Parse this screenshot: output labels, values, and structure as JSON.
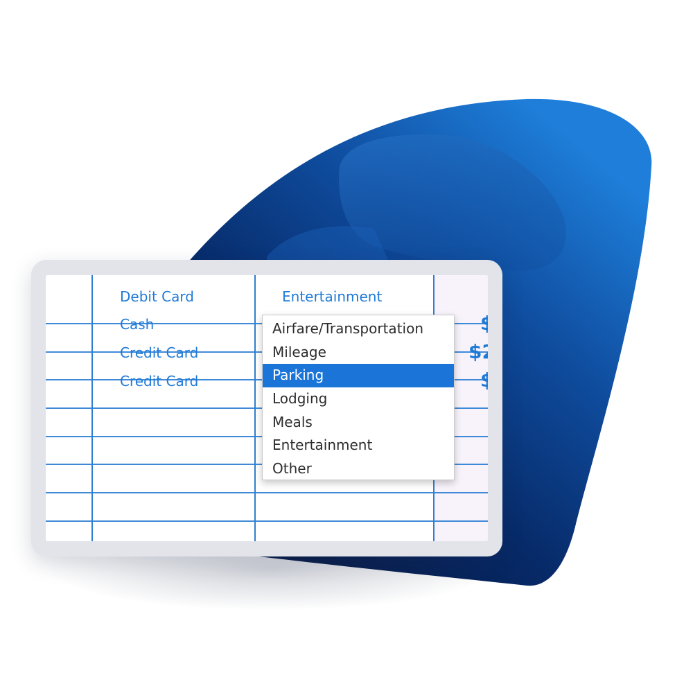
{
  "colors": {
    "accent": "#1f7ad6",
    "selected_bg": "#1b75d9",
    "grid_line": "#3f8ad8",
    "background_shape_dark": "#041a4a",
    "background_shape_light": "#1e7ed9"
  },
  "table": {
    "rows": [
      {
        "payment": "Debit Card",
        "category": "Entertainment",
        "amount": ""
      },
      {
        "payment": "Cash",
        "category": "",
        "amount": "$"
      },
      {
        "payment": "Credit Card",
        "category": "",
        "amount": "$2"
      },
      {
        "payment": "Credit Card",
        "category": "",
        "amount": "$"
      }
    ]
  },
  "dropdown": {
    "options": [
      "Airfare/Transportation",
      "Mileage",
      "Parking",
      "Lodging",
      "Meals",
      "Entertainment",
      "Other"
    ],
    "selected": "Parking",
    "selected_index": 2
  }
}
